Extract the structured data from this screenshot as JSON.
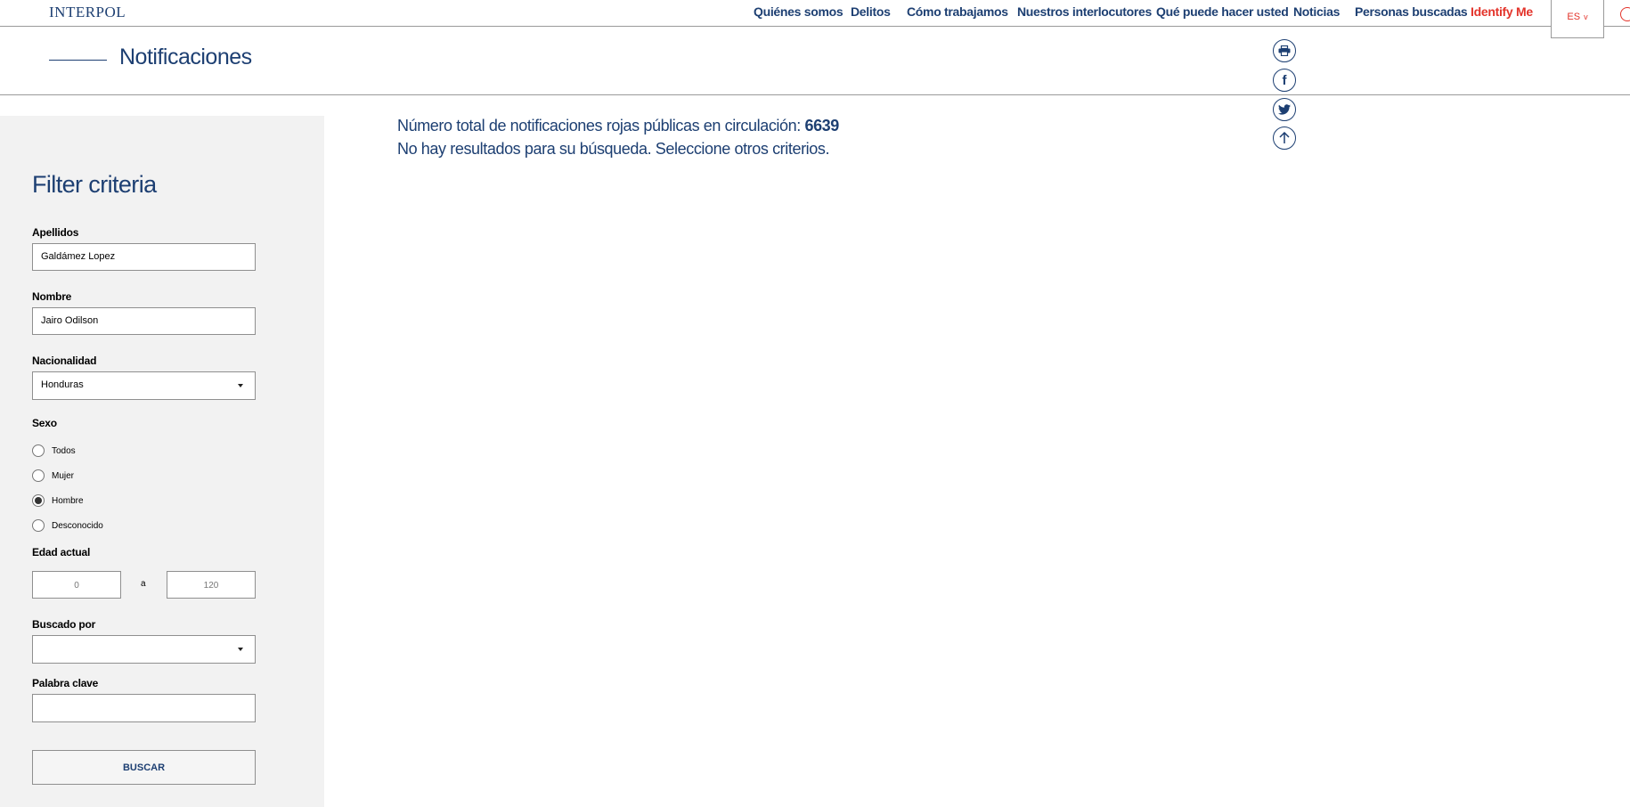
{
  "brand": {
    "logo": "INTERPOL"
  },
  "nav": {
    "items": [
      {
        "label": "Quiénes somos",
        "accent": false
      },
      {
        "label": "Delitos",
        "accent": false
      },
      {
        "label": "Cómo trabajamos",
        "accent": false
      },
      {
        "label": "Nuestros interlocutores",
        "accent": false
      },
      {
        "label": "Qué puede hacer usted",
        "accent": false
      },
      {
        "label": "Noticias",
        "accent": false
      },
      {
        "label": "Personas buscadas",
        "accent": false
      },
      {
        "label": "Identify Me",
        "accent": true
      }
    ],
    "language": "ES",
    "language_chevron": "v"
  },
  "page": {
    "title": "Notificaciones"
  },
  "share": [
    {
      "name": "print-icon"
    },
    {
      "name": "facebook-icon",
      "glyph": "f"
    },
    {
      "name": "twitter-icon"
    },
    {
      "name": "back-to-top-icon"
    }
  ],
  "filters": {
    "title": "Filter criteria",
    "apellidos": {
      "label": "Apellidos",
      "value": "Galdámez Lopez"
    },
    "nombre": {
      "label": "Nombre",
      "value": "Jairo Odilson"
    },
    "nacionalidad": {
      "label": "Nacionalidad",
      "value": "Honduras"
    },
    "sexo": {
      "label": "Sexo",
      "options": [
        {
          "label": "Todos",
          "checked": false
        },
        {
          "label": "Mujer",
          "checked": false
        },
        {
          "label": "Hombre",
          "checked": true
        },
        {
          "label": "Desconocido",
          "checked": false
        }
      ]
    },
    "edad": {
      "label": "Edad actual",
      "min": "0",
      "separator": "a",
      "max": "120"
    },
    "buscado_por": {
      "label": "Buscado por",
      "value": ""
    },
    "palabra_clave": {
      "label": "Palabra clave",
      "value": ""
    },
    "submit_label": "BUSCAR"
  },
  "results": {
    "total_text": "Número total de notificaciones rojas públicas en circulación: ",
    "total_count": "6639",
    "empty_message": "No hay resultados para su búsqueda. Seleccione otros criterios."
  },
  "colors": {
    "brand": "#1d3f72",
    "accent": "#e3332a",
    "sidebar_bg": "#f2f2f2"
  }
}
